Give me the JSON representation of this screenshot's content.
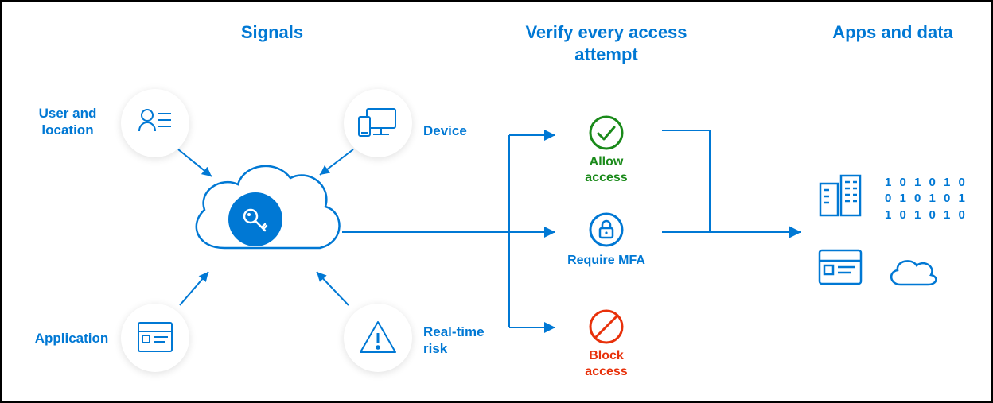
{
  "columns": {
    "signals": "Signals",
    "verify": "Verify every access attempt",
    "apps": "Apps and data"
  },
  "signals": {
    "user_location": "User and location",
    "device": "Device",
    "application": "Application",
    "risk": "Real-time risk"
  },
  "verify": {
    "allow": "Allow access",
    "mfa": "Require MFA",
    "block": "Block access"
  },
  "binary": "1 0 1 0 1 0\n0 1 0 1 0 1\n1 0 1 0 1 0",
  "colors": {
    "blue": "#0078d4",
    "green": "#1a8a1a",
    "red": "#e8310b"
  }
}
